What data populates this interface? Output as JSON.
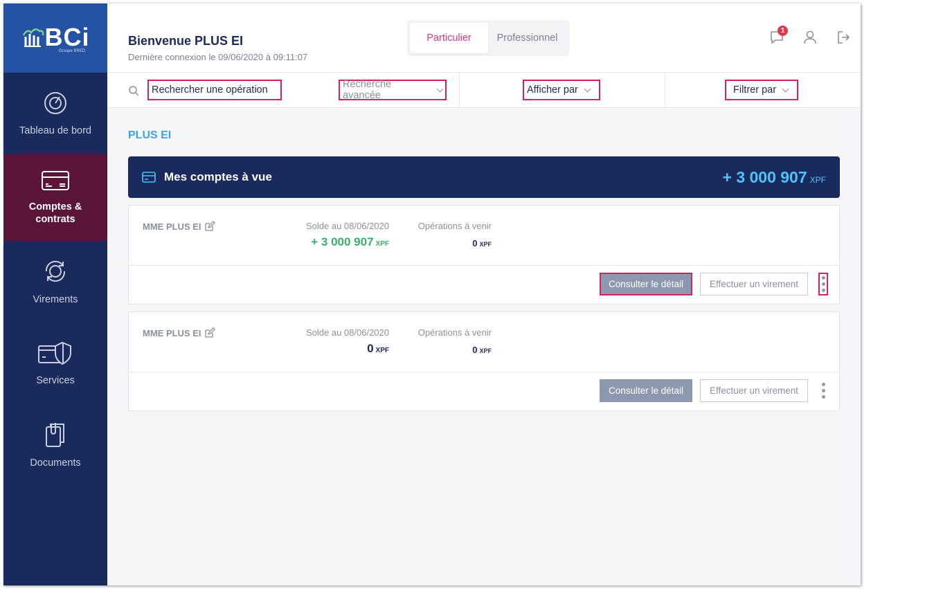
{
  "brand": {
    "logo_text": "BCi",
    "logo_sub": "Groupe BRED"
  },
  "sidebar": {
    "items": [
      {
        "label": "Tableau de bord",
        "icon": "dashboard-gauge-icon"
      },
      {
        "label": "Comptes & contrats",
        "icon": "card-icon",
        "active": true
      },
      {
        "label": "Virements",
        "icon": "transfer-icon"
      },
      {
        "label": "Services",
        "icon": "shield-card-icon"
      },
      {
        "label": "Documents",
        "icon": "clipboard-icon"
      }
    ]
  },
  "header": {
    "welcome": "Bienvenue PLUS EI",
    "last_connection": "Dernière connexion le 09/06/2020 à 09:11:07",
    "tabs": [
      "Particulier",
      "Professionnel"
    ],
    "notifications_count": "1"
  },
  "searchbar": {
    "search": "Rechercher une opération",
    "advanced": "Recherche avancée",
    "display_by": "Afficher par",
    "filter_by": "Filtrer par"
  },
  "section_title": "PLUS EI",
  "banner": {
    "title": "Mes comptes à vue",
    "total": "+ 3 000 907",
    "currency": "XPF"
  },
  "accounts": [
    {
      "name": "MME PLUS EI",
      "balance_label": "Solde au 08/06/2020",
      "balance": "+ 3 000 907",
      "currency": "XPF",
      "upcoming_label": "Opérations à venir",
      "upcoming": "0",
      "upcoming_currency": "XPF",
      "detail_button": "Consulter le détail",
      "transfer_button": "Effectuer un virement"
    },
    {
      "name": "MME PLUS EI",
      "balance_label": "Solde au 08/06/2020",
      "balance": "0",
      "currency": "XPF",
      "upcoming_label": "Opérations à venir",
      "upcoming": "0",
      "upcoming_currency": "XPF",
      "detail_button": "Consulter le détail",
      "transfer_button": "Effectuer un virement"
    }
  ],
  "colors": {
    "navy": "#1b2a5c",
    "accent_pink": "#d63a8a",
    "highlight": "#d0245f",
    "positive": "#3bb06a",
    "total": "#4fc3f7"
  }
}
